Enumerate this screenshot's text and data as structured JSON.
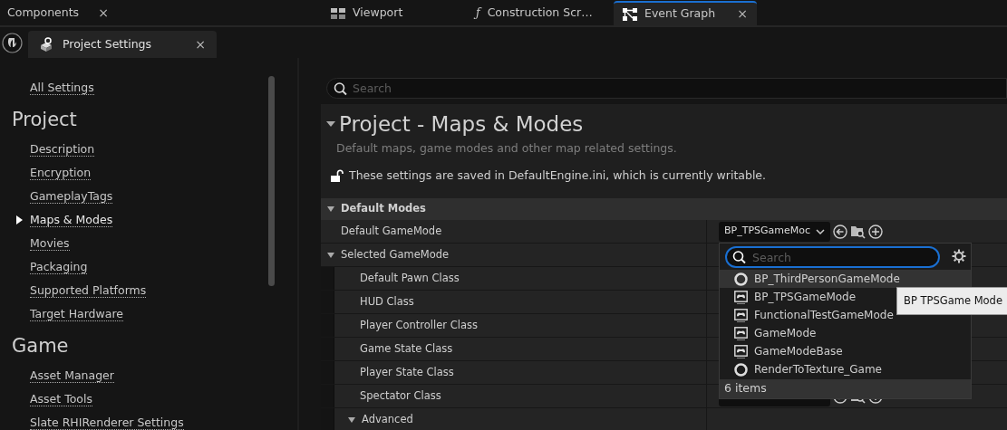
{
  "tabs": [
    {
      "label": "Components",
      "selected": false,
      "close": "×"
    },
    {
      "label": "Viewport",
      "selected": false,
      "kind": "grid"
    },
    {
      "label": "Construction Scr…",
      "selected": false,
      "icon_char": "ƒ"
    },
    {
      "label": "Event Graph",
      "selected": true,
      "kind": "graph",
      "close": "×"
    }
  ],
  "editor_tab": {
    "label": "Project Settings",
    "close": "×"
  },
  "sidebar": {
    "top_link": "All Settings",
    "groups": [
      {
        "title": "Project",
        "items": [
          {
            "label": "Description",
            "selected": false
          },
          {
            "label": "Encryption",
            "selected": false
          },
          {
            "label": "GameplayTags",
            "selected": false
          },
          {
            "label": "Maps & Modes",
            "selected": true
          },
          {
            "label": "Movies",
            "selected": false
          },
          {
            "label": "Packaging",
            "selected": false
          },
          {
            "label": "Supported Platforms",
            "selected": false
          },
          {
            "label": "Target Hardware",
            "selected": false
          }
        ]
      },
      {
        "title": "Game",
        "items": [
          {
            "label": "Asset Manager",
            "selected": false
          },
          {
            "label": "Asset Tools",
            "selected": false
          },
          {
            "label": "Slate RHIRenderer Settings",
            "selected": false
          }
        ]
      }
    ]
  },
  "search": {
    "placeholder": "Search"
  },
  "page": {
    "title": "Project - Maps & Modes",
    "expanded": true,
    "description": "Default maps, game modes and other map related settings.",
    "locked": false,
    "notice": "These settings are saved in DefaultEngine.ini, which is currently writable."
  },
  "sections": [
    {
      "title": "Default Modes",
      "expanded": true,
      "rows": [
        {
          "label": "Default GameMode",
          "value": "BP_TPSGameMoc",
          "kind": "combo"
        },
        {
          "label": "Selected GameMode",
          "kind": "group",
          "expanded": true,
          "children": [
            {
              "label": "Default Pawn Class",
              "kind": "plain"
            },
            {
              "label": "HUD Class",
              "kind": "plain"
            },
            {
              "label": "Player Controller Class",
              "kind": "plain"
            },
            {
              "label": "Game State Class",
              "kind": "plain"
            },
            {
              "label": "Player State Class",
              "kind": "plain"
            },
            {
              "label": "Spectator Class",
              "kind": "combo"
            },
            {
              "label": "Advanced",
              "kind": "group",
              "expanded": true
            }
          ]
        }
      ]
    }
  ],
  "picker": {
    "search": {
      "placeholder": "Search",
      "focused": true
    },
    "items": [
      {
        "label": "BP_ThirdPersonGameMode",
        "kind": "blueprint",
        "highlighted": true
      },
      {
        "label": "BP_TPSGameMode",
        "kind": "native",
        "highlighted": false
      },
      {
        "label": "FunctionalTestGameMode",
        "kind": "native",
        "highlighted": false
      },
      {
        "label": "GameMode",
        "kind": "native",
        "highlighted": false
      },
      {
        "label": "GameModeBase",
        "kind": "native",
        "highlighted": false
      },
      {
        "label": "RenderToTexture_Game",
        "kind": "blueprint",
        "highlighted": false
      }
    ],
    "count": "6 items",
    "tooltip": "BP TPSGame Mode"
  }
}
